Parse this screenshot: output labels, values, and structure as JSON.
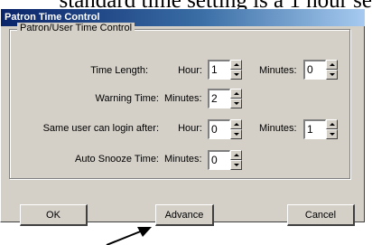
{
  "background_text": "standard time setting is a 1 hour se",
  "window": {
    "title": "Patron Time Control"
  },
  "group": {
    "legend": "Patron/User Time Control",
    "rows": {
      "time_length": {
        "label": "Time Length:",
        "hour_label": "Hour:",
        "hour_value": "1",
        "minutes_label": "Minutes:",
        "minutes_value": "0"
      },
      "warning_time": {
        "label": "Warning Time:",
        "minutes_label": "Minutes:",
        "minutes_value": "2"
      },
      "same_user": {
        "label": "Same user can login after:",
        "hour_label": "Hour:",
        "hour_value": "0",
        "minutes_label": "Minutes:",
        "minutes_value": "1"
      },
      "auto_snooze": {
        "label": "Auto Snooze Time:",
        "minutes_label": "Minutes:",
        "minutes_value": "0"
      }
    }
  },
  "buttons": {
    "ok": "OK",
    "advance": "Advance",
    "cancel": "Cancel"
  },
  "icons": {
    "pointer": "arrow-pointer-icon",
    "spin_up": "spin-up-icon",
    "spin_down": "spin-down-icon"
  }
}
